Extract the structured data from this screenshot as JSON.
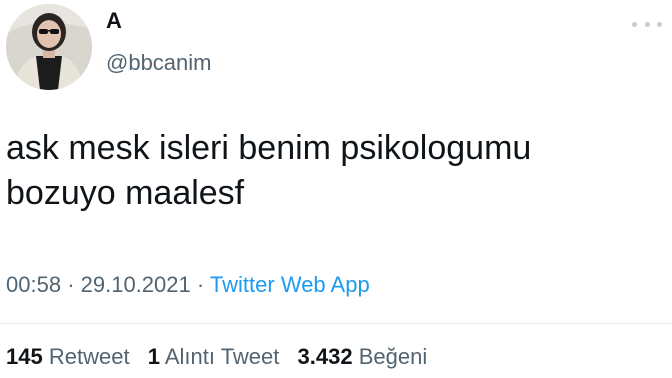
{
  "author": {
    "display_name": "A",
    "handle": "@bbcanim"
  },
  "tweet": {
    "text_line1": "ask mesk isleri benim psikologumu",
    "text_line2": "bozuyo maalesf",
    "time": "00:58",
    "separator": "·",
    "date": "29.10.2021",
    "source": "Twitter Web App"
  },
  "stats": {
    "retweets_count": "145",
    "retweets_label": "Retweet",
    "quotes_count": "1",
    "quotes_label": "Alıntı Tweet",
    "likes_count": "3.432",
    "likes_label": "Beğeni"
  },
  "icons": {
    "more": "more-horizontal-icon"
  },
  "colors": {
    "text_primary": "#0f1419",
    "text_secondary": "#536471",
    "link": "#1d9bf0",
    "divider": "#e6ecf0"
  }
}
